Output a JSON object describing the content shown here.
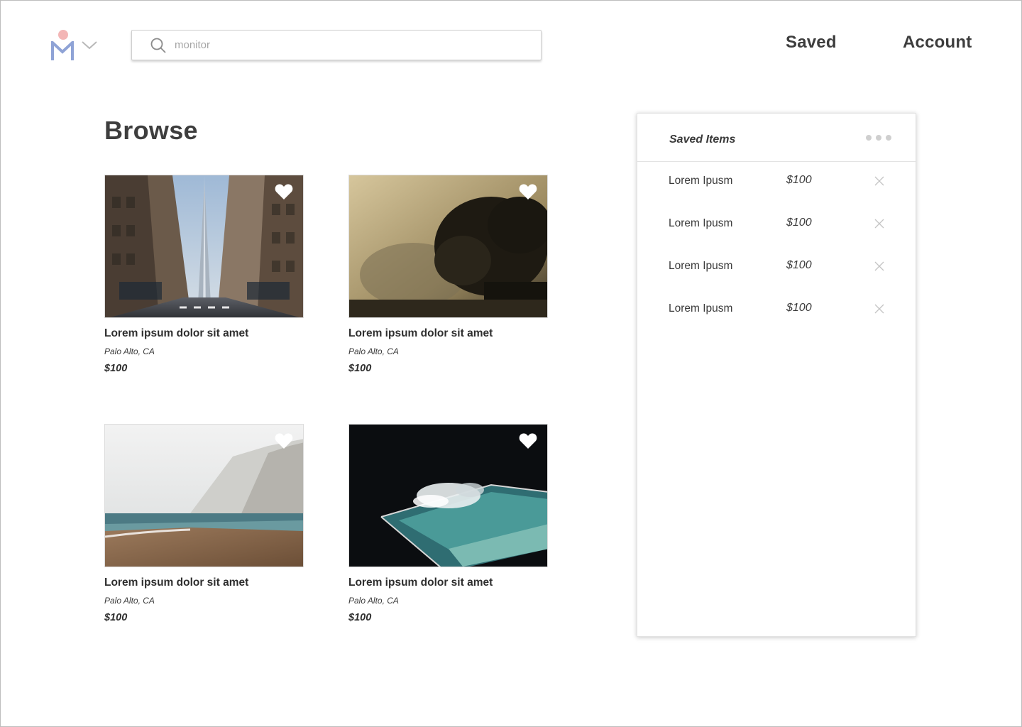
{
  "header": {
    "search_placeholder": "monitor",
    "nav": {
      "saved": "Saved",
      "account": "Account"
    }
  },
  "brand_colors": {
    "logo_dot": "#f3b6b6",
    "logo_m": "#8fa3d6"
  },
  "icons": [
    "logo-mark",
    "chevron-down-icon",
    "search-icon",
    "heart-icon",
    "more-dots-icon",
    "close-icon"
  ],
  "browse": {
    "title": "Browse",
    "cards": [
      {
        "title": "Lorem ipsum dolor sit amet",
        "location": "Palo Alto, CA",
        "price": "$100",
        "image": "city street with skyscraper"
      },
      {
        "title": "Lorem ipsum dolor sit amet",
        "location": "Palo Alto, CA",
        "price": "$100",
        "image": "tree silhouette in golden fog"
      },
      {
        "title": "Lorem ipsum dolor sit amet",
        "location": "Palo Alto, CA",
        "price": "$100",
        "image": "beach with chalk cliffs in mist"
      },
      {
        "title": "Lorem ipsum dolor sit amet",
        "location": "Palo Alto, CA",
        "price": "$100",
        "image": "ocean pool with crashing wave at night"
      }
    ]
  },
  "saved_panel": {
    "title": "Saved Items",
    "items": [
      {
        "name": "Lorem Ipusm",
        "price": "$100"
      },
      {
        "name": "Lorem Ipusm",
        "price": "$100"
      },
      {
        "name": "Lorem Ipusm",
        "price": "$100"
      },
      {
        "name": "Lorem Ipusm",
        "price": "$100"
      }
    ]
  }
}
